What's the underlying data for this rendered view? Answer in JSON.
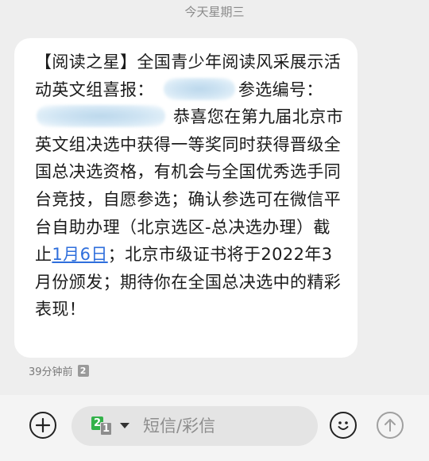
{
  "thread": {
    "date_separator": "今天星期三"
  },
  "message": {
    "part1": "【阅读之星】全国青少年阅读风采展示活动英文组喜报：",
    "part2": "参选编号：",
    "part3": "恭喜您在第九届北京市英文组决选中获得一等奖同时获得晋级全国总决选资格，有机会与全国优秀选手同台竞技，自愿参选；确认参选可在微信平台自助办理（北京选区-总决选办理）截止",
    "date_link": "1月6日",
    "part4": "；北京市级证书将于2022年3月份颁发；期待你在全国总决选中的精彩表现！",
    "timestamp": "39分钟前",
    "sim_slot": "2"
  },
  "composer": {
    "placeholder": "短信/彩信",
    "sim_primary": "2",
    "sim_secondary": "1",
    "icons": [
      "plus-icon",
      "chevron-down-icon",
      "emoji-icon",
      "send-arrow-icon"
    ]
  },
  "colors": {
    "background": "#eeeeee",
    "bubble": "#ffffff",
    "link": "#2f6fdc",
    "sim_green": "#33b24a"
  }
}
